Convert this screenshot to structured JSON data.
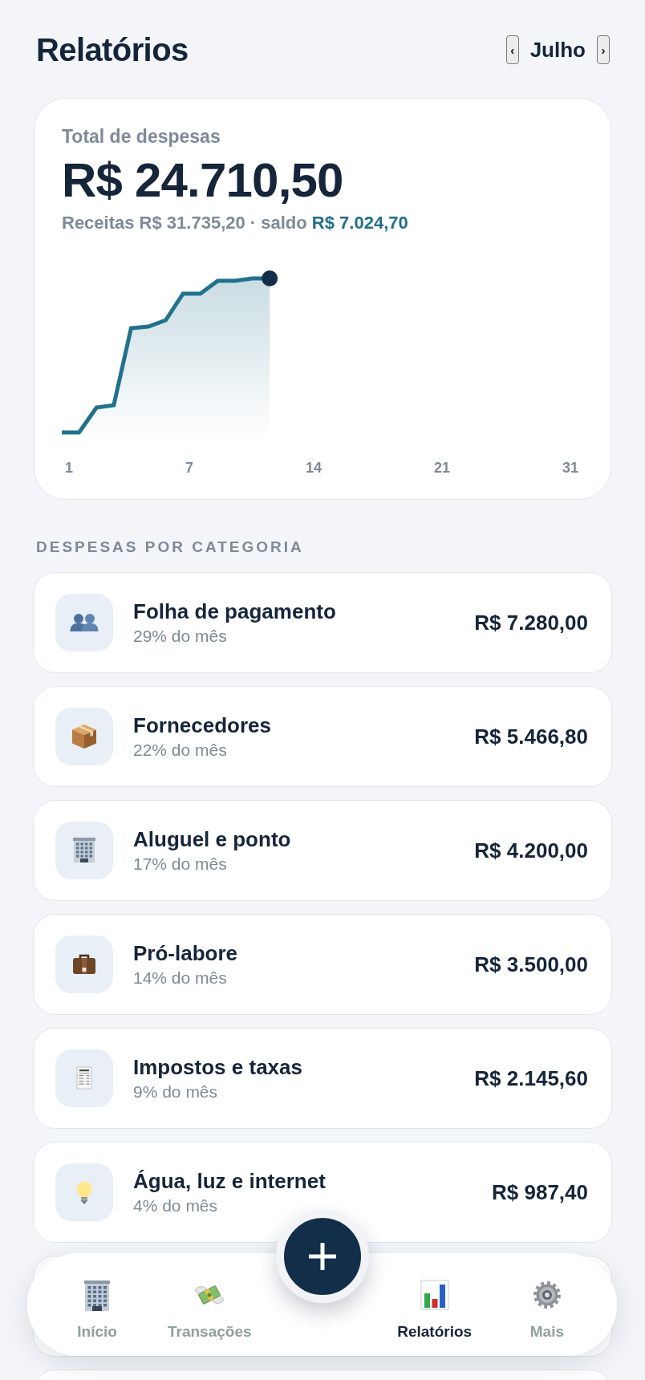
{
  "header": {
    "title": "Relatórios",
    "month_switcher": {
      "prev": "‹",
      "month": "Julho",
      "next": "›"
    }
  },
  "summary": {
    "label": "Total de despesas",
    "total": "R$ 24.710,50",
    "income_line": "Receitas R$ 31.735,20 · saldo",
    "balance": "R$ 7.024,70",
    "chart": {
      "x_labels": [
        "1",
        "7",
        "14",
        "21",
        "31"
      ]
    }
  },
  "categories": {
    "heading": "DESPESAS POR CATEGORIA",
    "items": [
      {
        "name": "Folha de pagamento",
        "share": "29% do mês",
        "amount": "R$ 7.280,00"
      },
      {
        "name": "Fornecedores",
        "share": "22% do mês",
        "amount": "R$ 5.466,80"
      },
      {
        "name": "Aluguel e ponto",
        "share": "17% do mês",
        "amount": "R$ 4.200,00"
      },
      {
        "name": "Pró-labore",
        "share": "14% do mês",
        "amount": "R$ 3.500,00"
      },
      {
        "name": "Impostos e taxas",
        "share": "9% do mês",
        "amount": "R$ 2.145,60"
      },
      {
        "name": "Água, luz e internet",
        "share": "4% do mês",
        "amount": "R$ 987,40"
      }
    ]
  },
  "bottom_nav": [
    {
      "label": "Início",
      "selected": false
    },
    {
      "label": "Transações",
      "selected": false
    },
    {
      "label": "Relatórios",
      "selected": true
    },
    {
      "label": "Mais",
      "selected": false
    }
  ]
}
